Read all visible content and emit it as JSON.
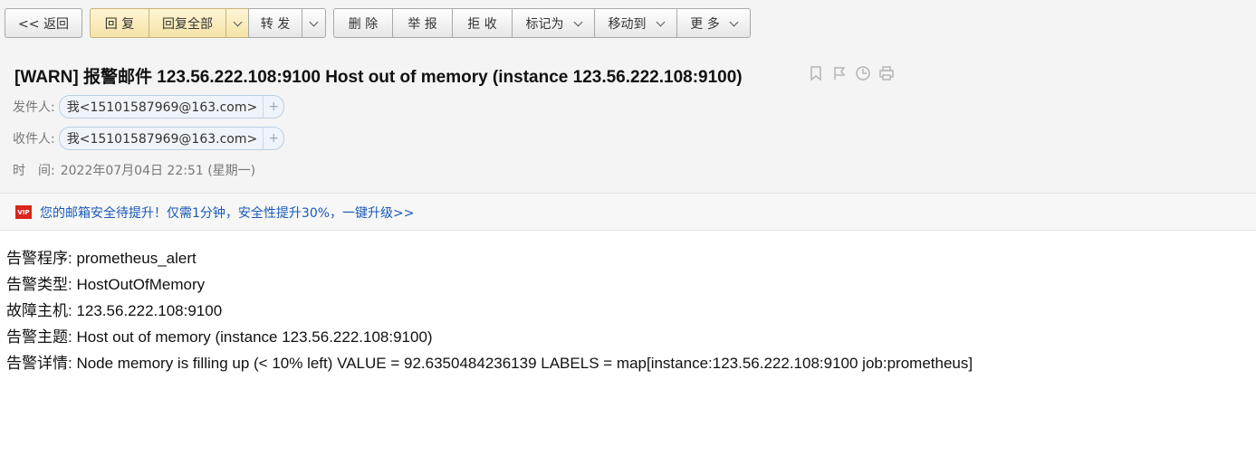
{
  "toolbar": {
    "back": "<< 返回",
    "reply": "回 复",
    "reply_all": "回复全部",
    "forward": "转 发",
    "delete": "删 除",
    "report": "举 报",
    "reject": "拒 收",
    "mark_as": "标记为",
    "move_to": "移动到",
    "more": "更 多"
  },
  "subject": "[WARN] 报警邮件 123.56.222.108:9100 Host out of memory (instance 123.56.222.108:9100)",
  "meta": {
    "from_label": "发件人:",
    "from_value": "我<15101587969@163.com>",
    "to_label": "收件人:",
    "to_value": "我<15101587969@163.com>",
    "time_label": "时　间:",
    "time_value": "2022年07月04日 22:51 (星期一)",
    "add": "+"
  },
  "vip": {
    "badge": "VIP",
    "text": "您的邮箱安全待提升！仅需1分钟，安全性提升30%，一键升级>>"
  },
  "body": {
    "lines": [
      "告警程序: prometheus_alert",
      "告警类型: HostOutOfMemory",
      "故障主机: 123.56.222.108:9100",
      "告警主题: Host out of memory (instance 123.56.222.108:9100)",
      "告警详情: Node memory is filling up (< 10% left) VALUE = 92.6350484236139 LABELS = map[instance:123.56.222.108:9100 job:prometheus]"
    ]
  },
  "colors": {
    "link": "#1a5ab8",
    "vip_badge": "#d9251c",
    "reply_bg": "#f5e3a6"
  },
  "icons": [
    "bookmark-icon",
    "flag-icon",
    "clock-icon",
    "print-icon",
    "chevron-down-icon"
  ]
}
